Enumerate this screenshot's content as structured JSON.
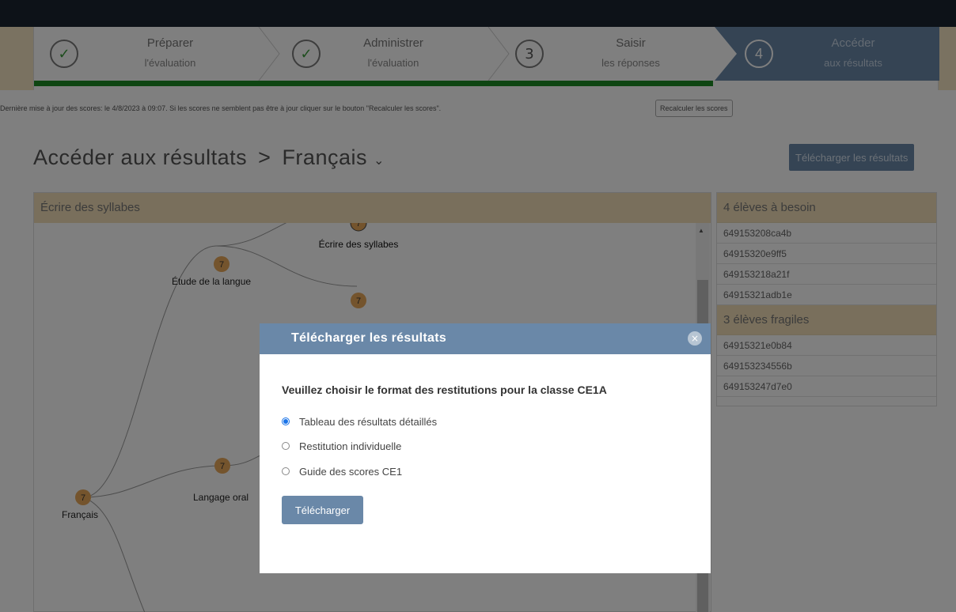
{
  "stepper": {
    "steps": [
      {
        "icon": "check",
        "line1": "Préparer",
        "line2": "l'évaluation"
      },
      {
        "icon": "check",
        "line1": "Administrer",
        "line2": "l'évaluation"
      },
      {
        "number": "3",
        "line1": "Saisir",
        "line2": "les réponses"
      },
      {
        "number": "4",
        "line1": "Accéder",
        "line2": "aux résultats"
      }
    ]
  },
  "notice": {
    "text": "Dernière mise à jour des scores: le 4/8/2023 à 09:07. Si les scores ne semblent pas être à jour cliquer sur le bouton \"Recalculer les scores\".",
    "button": "Recalculer les scores"
  },
  "header": {
    "title": "Accéder aux résultats",
    "separator": ">",
    "subject": "Français",
    "download_button": "Télécharger les résultats"
  },
  "tree": {
    "panel_title": "Écrire des syllabes",
    "nodes": [
      {
        "label": "Écrire des syllabes",
        "value": "7"
      },
      {
        "label": "Étude de la langue",
        "value": "7"
      },
      {
        "label": "",
        "value": "7"
      },
      {
        "label": "Langage oral",
        "value": "7"
      },
      {
        "label": "Français",
        "value": "7"
      }
    ]
  },
  "groups": {
    "besoin_title": "4 élèves à besoin",
    "besoin": [
      "649153208ca4b",
      "64915320e9ff5",
      "649153218a21f",
      "64915321adb1e"
    ],
    "fragiles_title": "3 élèves fragiles",
    "fragiles": [
      "64915321e0b84",
      "649153234556b",
      "649153247d7e0"
    ]
  },
  "modal": {
    "title": "Télécharger les résultats",
    "close": "×",
    "question": "Veuillez choisir le format des restitutions pour la classe CE1A",
    "options": [
      {
        "label": "Tableau des résultats détaillés",
        "checked": true
      },
      {
        "label": "Restitution individuelle",
        "checked": false
      },
      {
        "label": "Guide des scores CE1",
        "checked": false
      }
    ],
    "submit": "Télécharger"
  },
  "colors": {
    "primary": "#6a88a8",
    "header_bg": "#f2dfb8",
    "progress": "#1c8a24",
    "node": "#e8a85a",
    "topbar": "#1b2431"
  }
}
